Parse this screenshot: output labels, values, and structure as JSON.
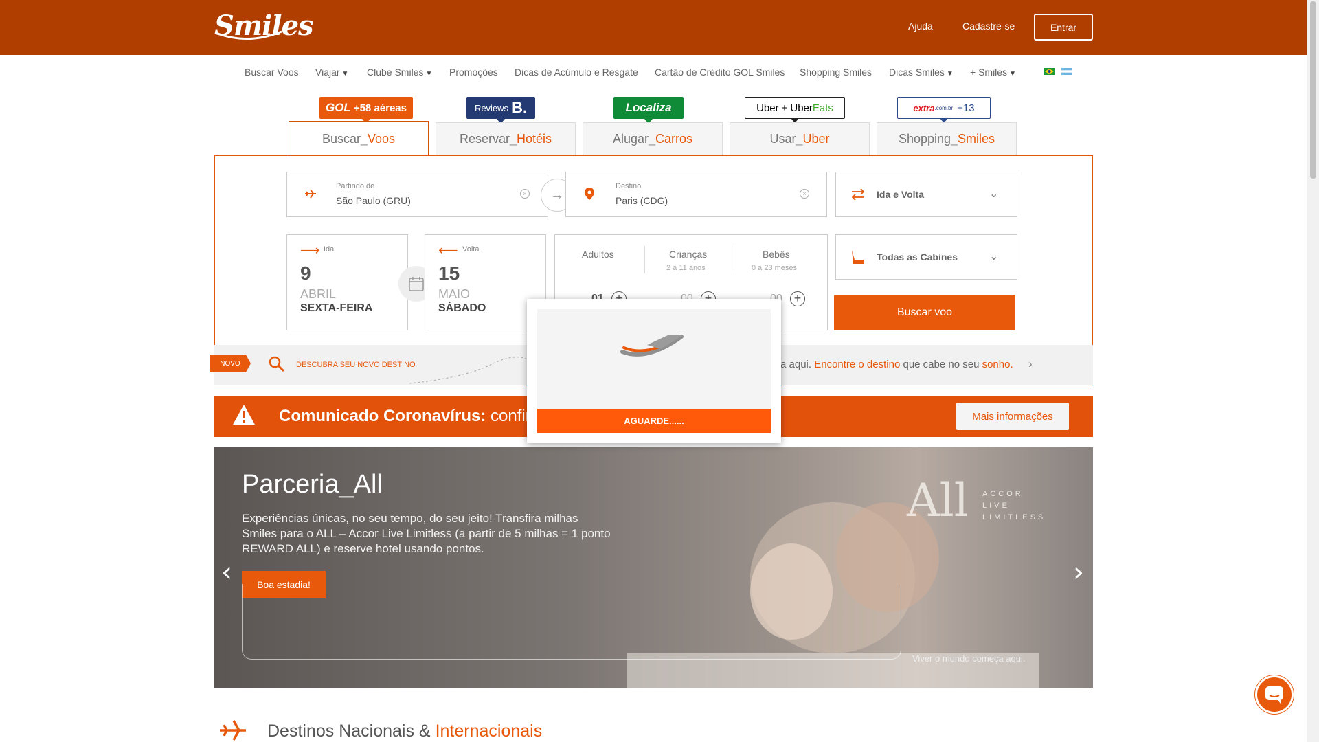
{
  "header": {
    "logo": "Smiles",
    "links": {
      "help": "Ajuda",
      "signup": "Cadastre-se"
    },
    "login": "Entrar"
  },
  "nav": {
    "items": [
      "Buscar Voos",
      "Viajar",
      "Clube Smiles",
      "Promoções",
      "Dicas de Acúmulo e Resgate",
      "Cartão de Crédito GOL Smiles",
      "Shopping Smiles",
      "Dicas Smiles",
      "+ Smiles"
    ]
  },
  "tabs": [
    {
      "badge_main": "GOL",
      "badge_extra": "+58 aéreas",
      "label_a": "Buscar",
      "label_b": "Voos",
      "active": true
    },
    {
      "badge_main": "Reviews",
      "badge_extra": "B.",
      "label_a": "Reservar",
      "label_b": "Hotéis"
    },
    {
      "badge_main": "Localiza",
      "label_a": "Alugar",
      "label_b": "Carros"
    },
    {
      "badge_main": "Uber",
      "badge_plus": "+",
      "badge_extra": "Uber",
      "badge_tail": "Eats",
      "label_a": "Usar",
      "label_b": "Uber"
    },
    {
      "badge_main": "extra",
      "badge_extra": ".com.br",
      "badge_tail": "+13",
      "label_a": "Shopping",
      "label_b": "Smiles"
    }
  ],
  "search": {
    "origin_label": "Partindo de",
    "origin_value": "São Paulo (GRU)",
    "destination_label": "Destino",
    "destination_value": "Paris (CDG)",
    "trip_type": "Ida e Volta",
    "depart": {
      "label": "Ida",
      "day": "9",
      "month": "ABRIL",
      "weekday": "SEXTA-FEIRA"
    },
    "return": {
      "label": "Volta",
      "day": "15",
      "month": "MAIO",
      "weekday": "SÁBADO"
    },
    "passengers": {
      "adults_label": "Adultos",
      "adults_value": "01",
      "children_label": "Crianças",
      "children_sub": "2 a 11 anos",
      "children_value": "00",
      "infants_label": "Bebês",
      "infants_sub": "0 a 23 meses",
      "infants_value": "00"
    },
    "cabin": "Todas as Cabines",
    "submit": "Buscar voo"
  },
  "discover": {
    "tag": "NOVO",
    "link": "DESCUBRA SEU NOVO DESTINO",
    "text_pre": "a aqui.",
    "text_link": "Encontre o destino",
    "text_mid": "que cabe no seu",
    "text_end": "sonho."
  },
  "covid": {
    "title": "Comunicado Coronavírus:",
    "rest": "confira a",
    "button": "Mais informações"
  },
  "hero": {
    "title_a": "Parceria",
    "title_b": "All",
    "text": "Experiências únicas, no seu tempo, do seu jeito! Transfira milhas Smiles para o ALL – Accor Live Limitless (a partir de 5 milhas = 1 ponto REWARD ALL) e reserve hotel usando pontos.",
    "button": "Boa estadia!",
    "tagline": "Viver o mundo começa aqui.",
    "partner_logo": "All",
    "partner_sub": [
      "ACCOR",
      "LIVE",
      "LIMITLESS"
    ]
  },
  "section": {
    "title_a": "Destinos Nacionais &",
    "title_b": "Internacionais"
  },
  "modal": {
    "status": "AGUARDE......"
  },
  "colors": {
    "header": "#b03e00",
    "accent": "#e8590c",
    "modal_button": "#ff5a0a"
  },
  "icons": [
    "plane-icon",
    "pin-icon",
    "swap-arrows-icon",
    "seat-icon",
    "calendar-icon",
    "warning-icon",
    "search-icon",
    "chat-icon",
    "chevron-down-icon"
  ]
}
